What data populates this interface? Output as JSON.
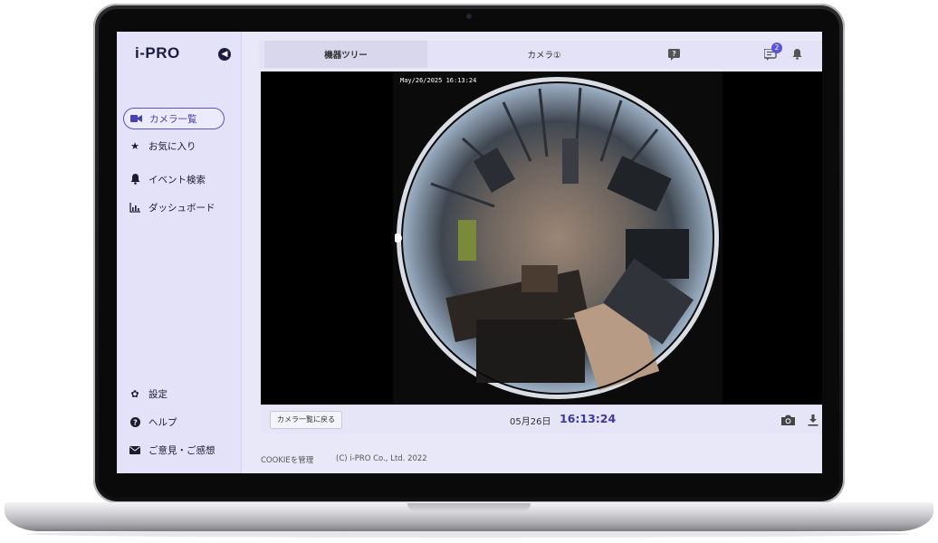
{
  "app": {
    "logo": "i-PRO"
  },
  "sidebar": {
    "top_items": [
      {
        "label": "カメラ一覧",
        "icon": "video-camera-icon",
        "active": true
      },
      {
        "label": "お気に入り",
        "icon": "star-icon"
      },
      {
        "label": "イベント検索",
        "icon": "bell-icon"
      },
      {
        "label": "ダッシュボード",
        "icon": "chart-icon"
      }
    ],
    "bottom_items": [
      {
        "label": "設定",
        "icon": "gear-icon"
      },
      {
        "label": "ヘルプ",
        "icon": "help-icon"
      },
      {
        "label": "ご意見・ご感想",
        "icon": "mail-icon"
      }
    ]
  },
  "tabs": [
    {
      "label": "機器ツリー",
      "active": true
    },
    {
      "label": "カメラ①"
    }
  ],
  "toolbar": {
    "notification_count": "2"
  },
  "video": {
    "overlay_timestamp": "May/26/2025 16:13:24"
  },
  "controls": {
    "back_label": "カメラ一覧に戻る",
    "date": "05月26日",
    "time": "16:13:24"
  },
  "footer": {
    "cookie_label": "COOKIEを管理",
    "copyright": "(C) i-PRO Co., Ltd. 2022"
  },
  "colors": {
    "accent": "#4640b4",
    "sidebar_bg": "#e4e2f8",
    "time_text": "#3a3aa0"
  }
}
